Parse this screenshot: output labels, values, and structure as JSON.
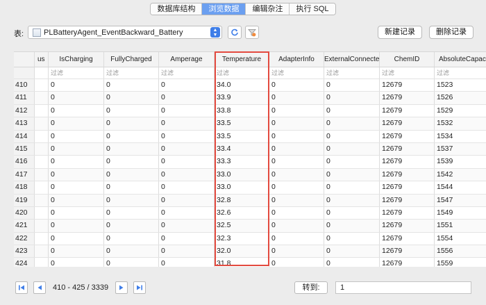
{
  "tabs": [
    {
      "label": "数据库结构",
      "active": false
    },
    {
      "label": "浏览数据",
      "active": true
    },
    {
      "label": "编辑杂注",
      "active": false
    },
    {
      "label": "执行 SQL",
      "active": false
    }
  ],
  "toolbar": {
    "table_label": "表:",
    "table_name": "PLBatteryAgent_EventBackward_Battery",
    "new_record": "新建记录",
    "delete_record": "删除记录"
  },
  "grid": {
    "columns": [
      "us",
      "IsCharging",
      "FullyCharged",
      "Amperage",
      "Temperature",
      "AdapterInfo",
      "ExternalConnected",
      "ChemID",
      "AbsoluteCapac"
    ],
    "filter_placeholder": "过滤",
    "highlighted_column": "Temperature",
    "rows": [
      {
        "id": "410",
        "cells": [
          "",
          "0",
          "0",
          "0",
          "34.0",
          "0",
          "0",
          "12679",
          "1523"
        ]
      },
      {
        "id": "411",
        "cells": [
          "",
          "0",
          "0",
          "0",
          "33.9",
          "0",
          "0",
          "12679",
          "1526"
        ]
      },
      {
        "id": "412",
        "cells": [
          "",
          "0",
          "0",
          "0",
          "33.8",
          "0",
          "0",
          "12679",
          "1529"
        ]
      },
      {
        "id": "413",
        "cells": [
          "",
          "0",
          "0",
          "0",
          "33.5",
          "0",
          "0",
          "12679",
          "1532"
        ]
      },
      {
        "id": "414",
        "cells": [
          "",
          "0",
          "0",
          "0",
          "33.5",
          "0",
          "0",
          "12679",
          "1534"
        ]
      },
      {
        "id": "415",
        "cells": [
          "",
          "0",
          "0",
          "0",
          "33.4",
          "0",
          "0",
          "12679",
          "1537"
        ]
      },
      {
        "id": "416",
        "cells": [
          "",
          "0",
          "0",
          "0",
          "33.3",
          "0",
          "0",
          "12679",
          "1539"
        ]
      },
      {
        "id": "417",
        "cells": [
          "",
          "0",
          "0",
          "0",
          "33.0",
          "0",
          "0",
          "12679",
          "1542"
        ]
      },
      {
        "id": "418",
        "cells": [
          "",
          "0",
          "0",
          "0",
          "33.0",
          "0",
          "0",
          "12679",
          "1544"
        ]
      },
      {
        "id": "419",
        "cells": [
          "",
          "0",
          "0",
          "0",
          "32.8",
          "0",
          "0",
          "12679",
          "1547"
        ]
      },
      {
        "id": "420",
        "cells": [
          "",
          "0",
          "0",
          "0",
          "32.6",
          "0",
          "0",
          "12679",
          "1549"
        ]
      },
      {
        "id": "421",
        "cells": [
          "",
          "0",
          "0",
          "0",
          "32.5",
          "0",
          "0",
          "12679",
          "1551"
        ]
      },
      {
        "id": "422",
        "cells": [
          "",
          "0",
          "0",
          "0",
          "32.3",
          "0",
          "0",
          "12679",
          "1554"
        ]
      },
      {
        "id": "423",
        "cells": [
          "",
          "0",
          "0",
          "0",
          "32.0",
          "0",
          "0",
          "12679",
          "1556"
        ]
      },
      {
        "id": "424",
        "cells": [
          "",
          "0",
          "0",
          "0",
          "31.8",
          "0",
          "0",
          "12679",
          "1559"
        ]
      }
    ]
  },
  "pager": {
    "range": "410 - 425 / 3339",
    "goto_label": "转到:",
    "goto_value": "1"
  },
  "colors": {
    "active_tab": "#6b9ff0",
    "highlight": "#e34a3f",
    "nav_blue": "#3f7ee8"
  }
}
